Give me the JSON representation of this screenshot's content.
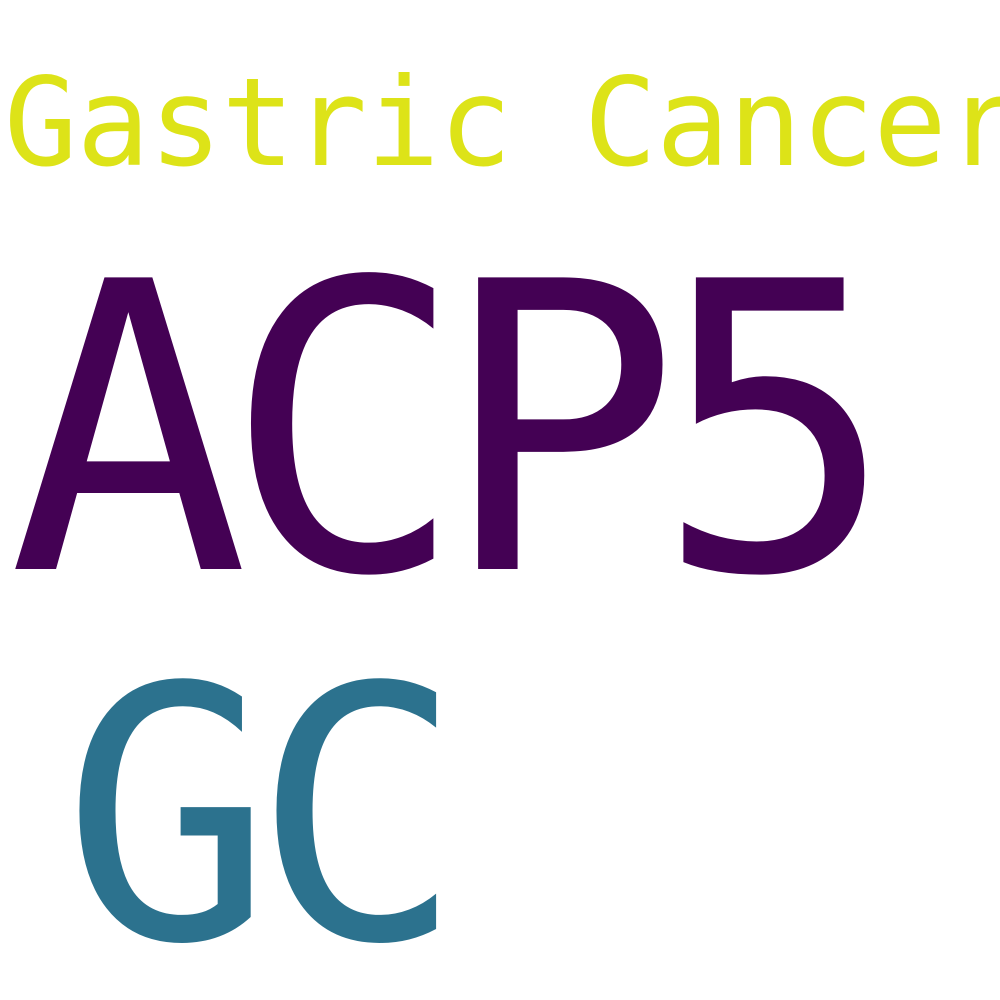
{
  "words": [
    {
      "text": "Gastric Cancer",
      "color": "#dde318"
    },
    {
      "text": "ACP5",
      "color": "#440154"
    },
    {
      "text": "GC",
      "color": "#2c728e"
    }
  ]
}
